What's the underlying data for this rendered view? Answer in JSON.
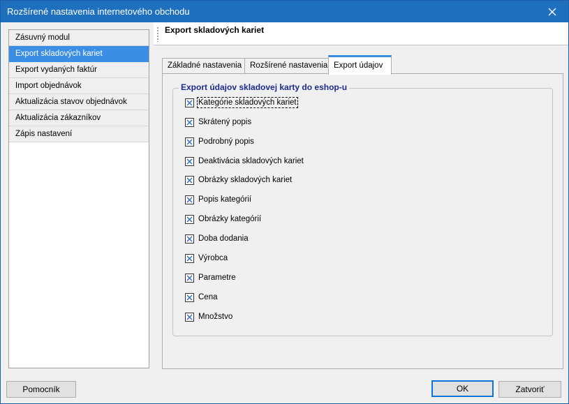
{
  "window": {
    "title": "Rozšírené nastavenia internetového obchodu"
  },
  "nav": {
    "items": [
      {
        "label": "Zásuvný modul",
        "selected": false
      },
      {
        "label": "Export skladových kariet",
        "selected": true
      },
      {
        "label": "Export vydaných faktúr",
        "selected": false
      },
      {
        "label": "Import objednávok",
        "selected": false
      },
      {
        "label": "Aktualizácia stavov objednávok",
        "selected": false
      },
      {
        "label": "Aktualizácia zákazníkov",
        "selected": false
      },
      {
        "label": "Zápis nastavení",
        "selected": false
      }
    ]
  },
  "panel": {
    "heading": "Export skladových kariet",
    "tabs": [
      {
        "label": "Základné nastavenia",
        "active": false
      },
      {
        "label": "Rozšírené nastavenia",
        "active": false
      },
      {
        "label": "Export údajov",
        "active": true
      }
    ],
    "group": {
      "legend": "Export údajov skladovej karty do eshop-u",
      "options": [
        {
          "label": "Kategórie skladových kariet",
          "checked": true
        },
        {
          "label": "Skrátený popis",
          "checked": true
        },
        {
          "label": "Podrobný popis",
          "checked": true
        },
        {
          "label": "Deaktivácia skladových kariet",
          "checked": true
        },
        {
          "label": "Obrázky skladových kariet",
          "checked": true
        },
        {
          "label": "Popis kategórií",
          "checked": true
        },
        {
          "label": "Obrázky kategórií",
          "checked": true
        },
        {
          "label": "Doba dodania",
          "checked": true
        },
        {
          "label": "Výrobca",
          "checked": true
        },
        {
          "label": "Parametre",
          "checked": true
        },
        {
          "label": "Cena",
          "checked": true
        },
        {
          "label": "Množstvo",
          "checked": true
        }
      ]
    }
  },
  "buttons": {
    "help": "Pomocník",
    "ok": "OK",
    "close": "Zatvoriť"
  },
  "colors": {
    "titlebar": "#1f6fbf",
    "selection": "#3a8ee6",
    "legend_text": "#1c2b8c",
    "active_tab_accent": "#3b8de3"
  }
}
